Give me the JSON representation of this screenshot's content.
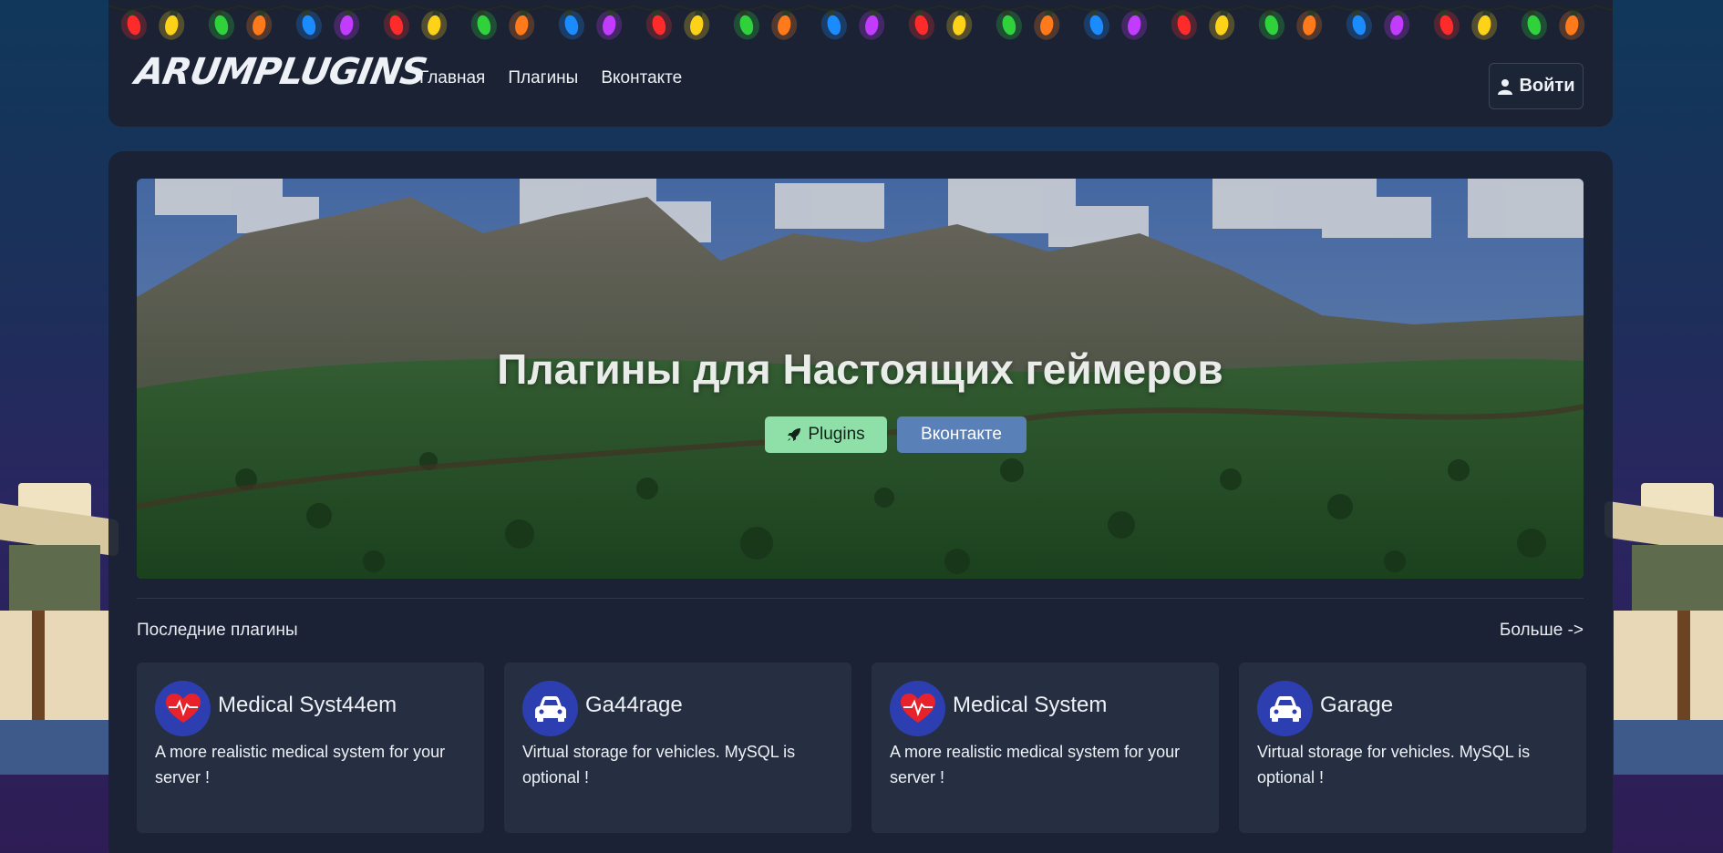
{
  "brand": "ARUMPLUGINS",
  "nav": {
    "links": [
      {
        "label": "Главная"
      },
      {
        "label": "Плагины"
      },
      {
        "label": "Вконтакте"
      }
    ],
    "login_label": "Войти"
  },
  "hero": {
    "title": "Плагины для Настоящих геймеров",
    "plugins_button": "Plugins",
    "vk_button": "Вконтакте"
  },
  "latest": {
    "title": "Последние плагины",
    "more_label": "Больше ->",
    "cards": [
      {
        "icon": "heart-pulse-icon",
        "title": "Medical Syst44em",
        "description": "A more realistic medical system for your server !"
      },
      {
        "icon": "car-icon",
        "title": "Ga44rage",
        "description": "Virtual storage for vehicles. MySQL is optional !"
      },
      {
        "icon": "heart-pulse-icon",
        "title": "Medical System",
        "description": "A more realistic medical system for your server !"
      },
      {
        "icon": "car-icon",
        "title": "Garage",
        "description": "Virtual storage for vehicles. MySQL is optional !"
      }
    ]
  },
  "colors": {
    "navbar": "#1a2233",
    "plugins_button": "#8fe0a8",
    "vk_button": "#5a80b8",
    "card": "#262f42",
    "icon_circle": "#2d3fb0"
  }
}
